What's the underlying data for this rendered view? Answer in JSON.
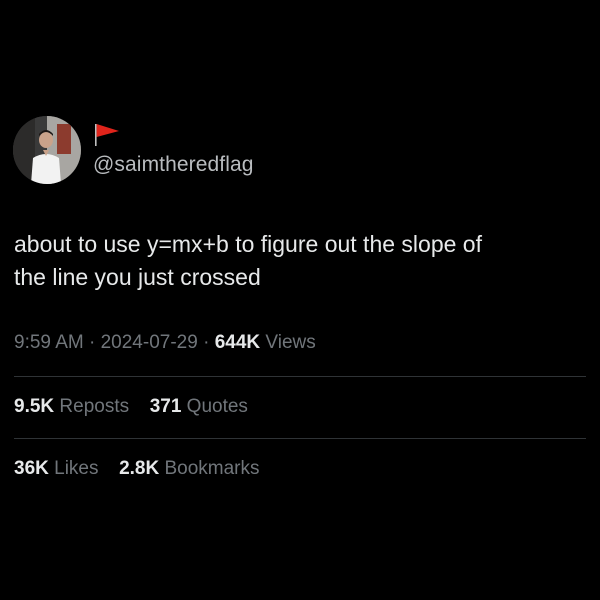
{
  "author": {
    "handle": "@saimtheredflag",
    "avatar_icon": "profile-photo-avatar",
    "emoji_icon": "red-flag-icon"
  },
  "tweet": {
    "text_lines": [
      "about to use y=mx+b to figure out the slope of",
      "the line you just crossed"
    ]
  },
  "meta": {
    "time": "9:59 AM",
    "separator": "·",
    "date": "2024-07-29",
    "views_count": "644K",
    "views_label": "Views"
  },
  "engagement": {
    "reposts_count": "9.5K",
    "reposts_label": "Reposts",
    "quotes_count": "371",
    "quotes_label": "Quotes",
    "likes_count": "36K",
    "likes_label": "Likes",
    "bookmarks_count": "2.8K",
    "bookmarks_label": "Bookmarks"
  },
  "colors": {
    "background": "#000000",
    "primary_text": "#e7e9ea",
    "secondary_text": "#71767b",
    "divider": "#2f3336",
    "flag": "#e0241b"
  }
}
